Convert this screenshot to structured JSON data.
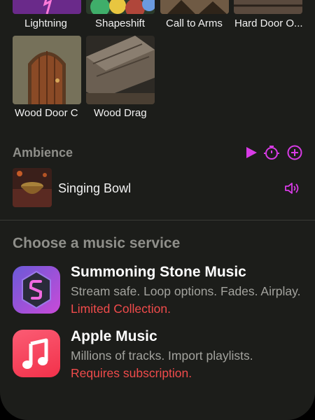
{
  "effects": [
    {
      "label": "Lightning"
    },
    {
      "label": "Shapeshift"
    },
    {
      "label": "Call to Arms"
    },
    {
      "label": "Hard Door O..."
    },
    {
      "label": "Wood Door C"
    },
    {
      "label": "Wood Drag"
    }
  ],
  "ambience": {
    "title": "Ambience",
    "item_label": "Singing Bowl",
    "icons": {
      "play": "play-icon",
      "timer": "timer-icon",
      "add": "add-circle-icon",
      "volume": "speaker-icon"
    }
  },
  "music": {
    "title": "Choose a music service",
    "services": [
      {
        "name": "Summoning Stone Music",
        "desc": "Stream safe. Loop options. Fades. Airplay. ",
        "warning": "Limited Collection."
      },
      {
        "name": "Apple Music",
        "desc": "Millions of tracks. Import playlists. ",
        "warning": "Requires subscription."
      }
    ]
  },
  "colors": {
    "accent": "#d83be6",
    "warning": "#f04b4b",
    "background": "#1c1d1a"
  }
}
